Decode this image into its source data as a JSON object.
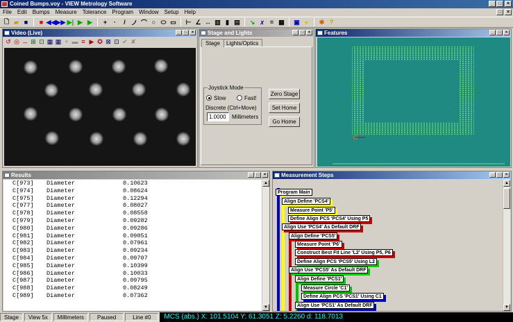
{
  "window": {
    "title": "Coined Bumps.voy - VIEW Metrology Software"
  },
  "menu": [
    "File",
    "Edit",
    "Bumps",
    "Measure",
    "Tolerance",
    "Program",
    "Window",
    "Setup",
    "Help"
  ],
  "video": {
    "title": "Video (Live)"
  },
  "stage": {
    "title": "Stage and Lights",
    "tabs": [
      "Stage",
      "Lights/Optics"
    ],
    "joystick_label": "Joystick Mode",
    "slow": "Slow",
    "fast": "Fast!",
    "discrete_label": "Discrete (Ctrl+Move)",
    "discrete_value": "1.0000",
    "units": "Millimeters",
    "zero_stage": "Zero Stage",
    "set_home": "Set Home",
    "go_home": "Go Home"
  },
  "features": {
    "title": "Features"
  },
  "results": {
    "title": "Results",
    "rows": [
      {
        "id": "C[973]",
        "name": "Diameter",
        "value": "0.10623"
      },
      {
        "id": "C[974]",
        "name": "Diameter",
        "value": "0.08624"
      },
      {
        "id": "C[975]",
        "name": "Diameter",
        "value": "0.12294"
      },
      {
        "id": "C[977]",
        "name": "Diameter",
        "value": "0.08027"
      },
      {
        "id": "C[978]",
        "name": "Diameter",
        "value": "0.08558"
      },
      {
        "id": "C[979]",
        "name": "Diameter",
        "value": "0.09282"
      },
      {
        "id": "C[980]",
        "name": "Diameter",
        "value": "0.09286"
      },
      {
        "id": "C[981]",
        "name": "Diameter",
        "value": "0.09851"
      },
      {
        "id": "C[982]",
        "name": "Diameter",
        "value": "0.07961"
      },
      {
        "id": "C[983]",
        "name": "Diameter",
        "value": "0.09234"
      },
      {
        "id": "C[984]",
        "name": "Diameter",
        "value": "0.09707"
      },
      {
        "id": "C[985]",
        "name": "Diameter",
        "value": "0.10399"
      },
      {
        "id": "C[986]",
        "name": "Diameter",
        "value": "0.10033"
      },
      {
        "id": "C[987]",
        "name": "Diameter",
        "value": "0.09795"
      },
      {
        "id": "C[988]",
        "name": "Diameter",
        "value": "0.08249"
      },
      {
        "id": "C[989]",
        "name": "Diameter",
        "value": "0.07362"
      }
    ]
  },
  "steps": {
    "title": "Measurement Steps",
    "items": [
      "Program Main",
      "Align Define 'PCS4'",
      "Measure Point 'P5'",
      "Define Align PCS 'PCS4' Using P5",
      "Align Use 'PCS4' As Default DRF",
      "Align Define 'PCS5'",
      "Measure Point 'P6'",
      "Construct Best Fit Line 'L2' Using P5, P6",
      "Define Align PCS 'PCS5' Using L2",
      "Align Use 'PCS5' As Default DRF",
      "Align Define 'PCS1'",
      "Measure Circle 'C1'",
      "Define Align PCS 'PCS1' Using C1",
      "Align Use 'PCS1' As Default DRF"
    ]
  },
  "status": {
    "stage": "Stage",
    "view": "View 5x",
    "units": "Millimeters",
    "state": "Paused",
    "line": "Line #0",
    "mcs": "MCS (abs.)  X: 101.5104  Y: 61.3051  Z: 5.2260  d: 118.7013"
  }
}
